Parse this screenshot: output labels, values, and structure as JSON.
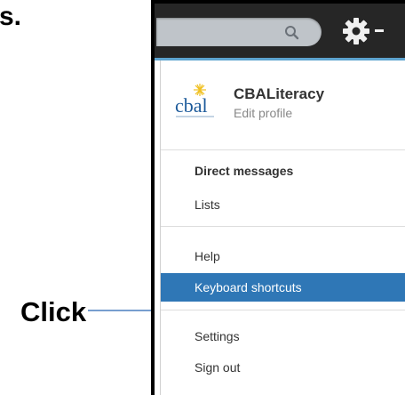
{
  "caption": {
    "corner_text": "s.",
    "click_label": "Click"
  },
  "topbar": {
    "search_placeholder": "",
    "search_icon": "magnifier-icon",
    "settings_icon": "gear-icon",
    "settings_caret": "dropdown-caret"
  },
  "profile": {
    "logo_text": "cbal",
    "name": "CBALiteracy",
    "edit_label": "Edit profile"
  },
  "menu": {
    "items": [
      {
        "label": "Direct messages"
      },
      {
        "label": "Lists"
      },
      {
        "label": "Help"
      },
      {
        "label": "Keyboard shortcuts"
      },
      {
        "label": "Settings"
      },
      {
        "label": "Sign out"
      }
    ]
  },
  "colors": {
    "topbar": "#262626",
    "highlight": "#2f77b6",
    "accent_line": "#5da3cf",
    "arrow": "#4a7fbf"
  }
}
